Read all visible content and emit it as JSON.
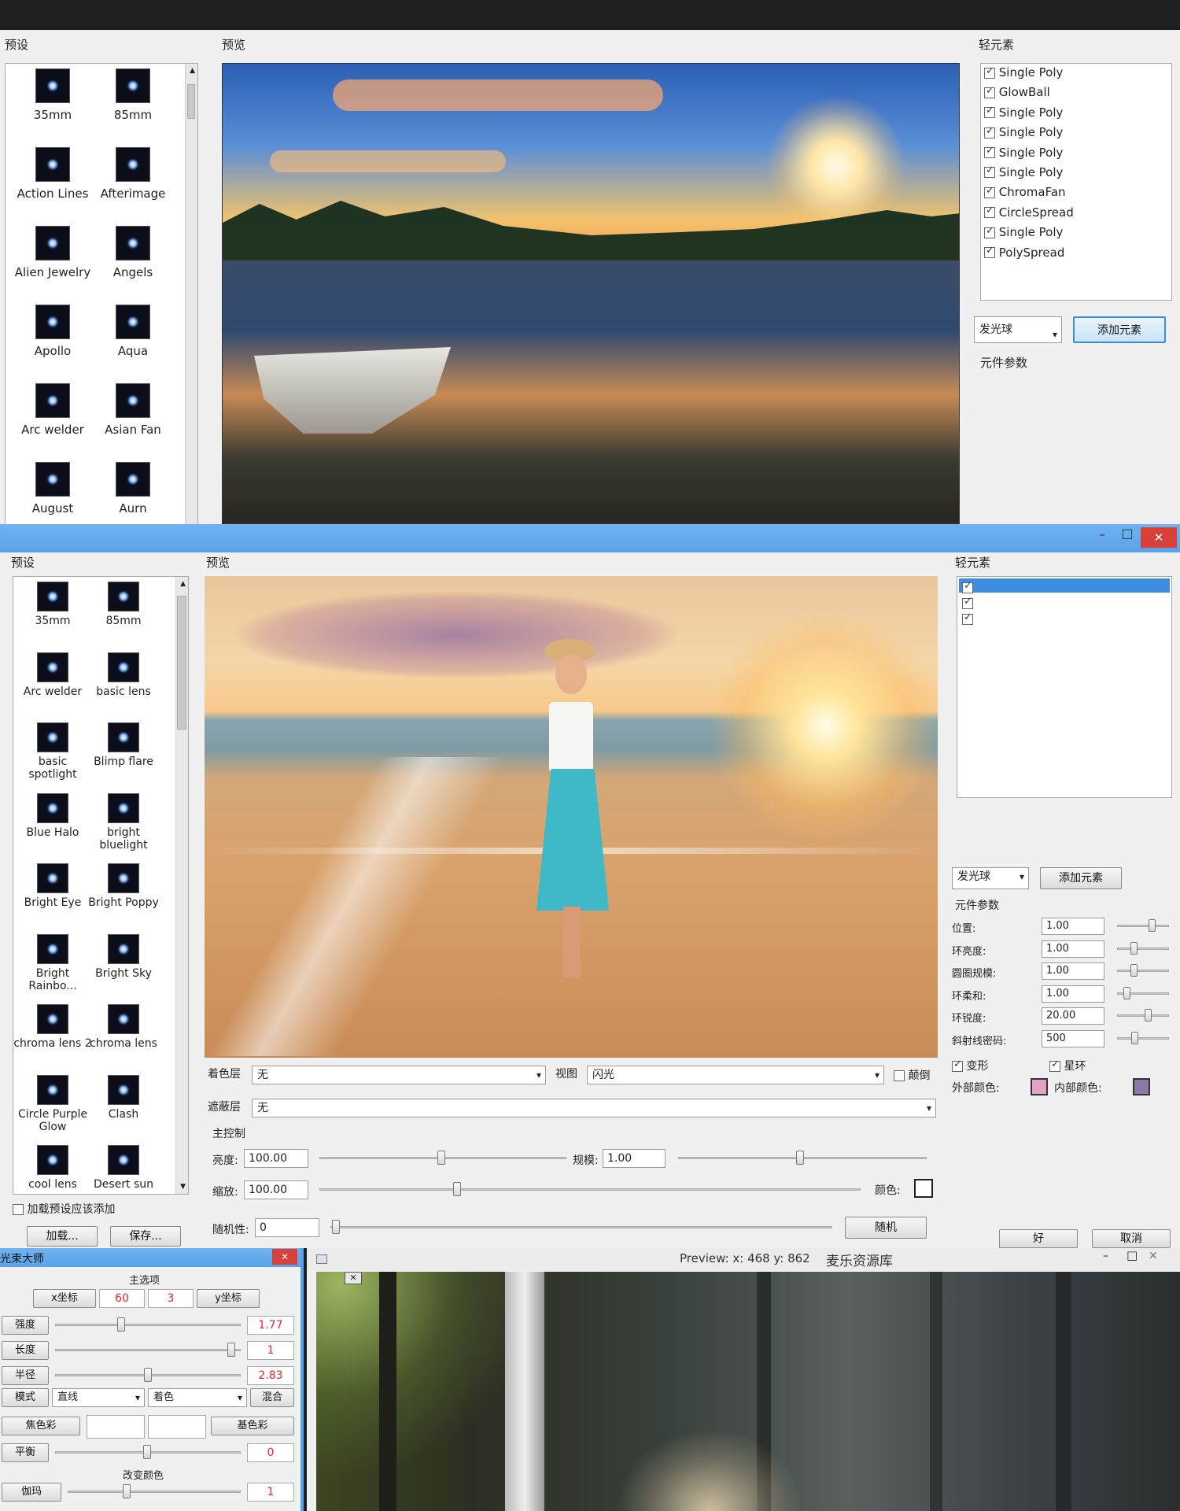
{
  "window1": {
    "presets_title": "预设",
    "preview_title": "预览",
    "elements_title": "轻元素",
    "presets": [
      "35mm",
      "85mm",
      "Action Lines",
      "Afterimage",
      "Alien Jewelry",
      "Angels",
      "Apollo",
      "Aqua",
      "Arc welder",
      "Asian Fan",
      "August",
      "Aurn"
    ],
    "elements": [
      "Single Poly",
      "GlowBall",
      "Single Poly",
      "Single Poly",
      "Single Poly",
      "Single Poly",
      "ChromaFan",
      "CircleSpread",
      "Single Poly",
      "PolySpread"
    ],
    "element_type_value": "发光球",
    "add_element_label": "添加元素",
    "element_params_label": "元件参数"
  },
  "window2": {
    "presets_title": "预设",
    "preview_title": "预览",
    "elements_title": "轻元素",
    "window_controls": {
      "minimize": "–",
      "maximize": "□",
      "close": "✕"
    },
    "presets": [
      "35mm",
      "85mm",
      "Arc welder",
      "basic lens",
      "basic spotlight",
      "Blimp flare",
      "Blue Halo",
      "bright bluelight",
      "Bright Eye",
      "Bright Poppy",
      "Bright Rainbo...",
      "Bright Sky",
      "chroma lens 2",
      "chroma lens",
      "Circle Purple Glow",
      "Clash",
      "cool lens",
      "Desert sun"
    ],
    "load_on_select_label": "加载预设应该添加",
    "load_btn": "加载...",
    "save_btn": "保存...",
    "blend_layer_label": "着色层",
    "blend_layer_value": "无",
    "view_label": "视图",
    "view_value": "闪光",
    "invert_label": "颠倒",
    "mask_layer_label": "遮蔽层",
    "mask_layer_value": "无",
    "main_control_label": "主控制",
    "brightness_label": "亮度:",
    "brightness_value": "100.00",
    "scale_label": "规模:",
    "scale_value": "1.00",
    "zoom_label": "缩放:",
    "zoom_value": "100.00",
    "color_label": "颜色:",
    "random_label": "随机性:",
    "random_value": "0",
    "random_btn": "随机",
    "element_type_value": "发光球",
    "add_element_label": "添加元素",
    "element_params_label": "元件参数",
    "params": [
      {
        "label": "位置:",
        "value": "1.00",
        "knob": 0.72
      },
      {
        "label": "环亮度:",
        "value": "1.00",
        "knob": 0.3
      },
      {
        "label": "圆圈规模:",
        "value": "1.00",
        "knob": 0.3
      },
      {
        "label": "环柔和:",
        "value": "1.00",
        "knob": 0.15
      },
      {
        "label": "环锐度:",
        "value": "20.00",
        "knob": 0.62
      },
      {
        "label": "斜射线密码:",
        "value": "500",
        "knob": 0.32
      }
    ],
    "deform_label": "变形",
    "ring_label": "星环",
    "outer_color_label": "外部颜色:",
    "inner_color_label": "内部颜色:",
    "outer_color": "#e6a2c5",
    "inner_color": "#8a7aa4",
    "ok_btn": "好",
    "cancel_btn": "取消"
  },
  "window3": {
    "title": "光束大师",
    "main_options_label": "主选项",
    "x_coord_label": "x坐标",
    "x_value": "60",
    "y_value": "3",
    "y_coord_label": "y坐标",
    "rows": [
      {
        "label": "强度",
        "value": "1.77",
        "knob": 0.35
      },
      {
        "label": "长度",
        "value": "1",
        "knob": 0.97
      },
      {
        "label": "半径",
        "value": "2.83",
        "knob": 0.5
      }
    ],
    "mode_label": "模式",
    "mode_value": "直线",
    "tint_value": "着色",
    "blend_btn": "混合",
    "start_color_label": "焦色彩",
    "end_color_label": "基色彩",
    "balance_label": "平衡",
    "balance_value": "0",
    "change_color_label": "改变颜色",
    "gamma_label": "伽玛",
    "gamma_value": "1",
    "preview_readout": "Preview:  x: 468 y: 862",
    "watermark": "麦乐资源库"
  }
}
